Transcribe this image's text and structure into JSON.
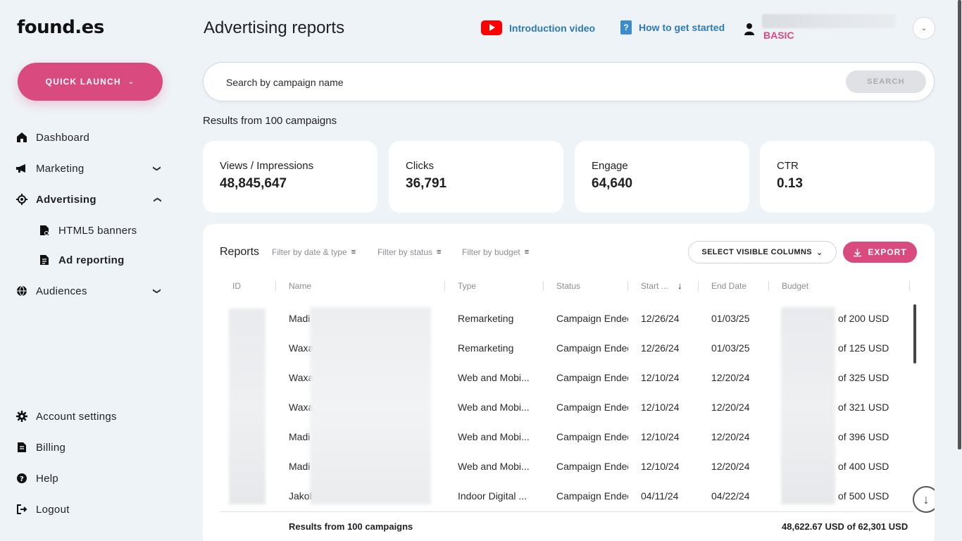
{
  "brand": {
    "logo_text": "found.es"
  },
  "sidebar": {
    "quick_launch": "QUICK LAUNCH",
    "items": [
      {
        "label": "Dashboard",
        "icon": "home-icon"
      },
      {
        "label": "Marketing",
        "icon": "megaphone-icon"
      },
      {
        "label": "Advertising",
        "icon": "target-icon"
      },
      {
        "label": "HTML5 banners",
        "icon": "banner-doc-icon"
      },
      {
        "label": "Ad reporting",
        "icon": "report-doc-icon"
      },
      {
        "label": "Audiences",
        "icon": "globe-icon"
      }
    ],
    "bottom": [
      {
        "label": "Account settings",
        "icon": "gear-icon"
      },
      {
        "label": "Billing",
        "icon": "billing-doc-icon"
      },
      {
        "label": "Help",
        "icon": "help-icon"
      },
      {
        "label": "Logout",
        "icon": "logout-icon"
      }
    ]
  },
  "header": {
    "title": "Advertising reports",
    "intro_video": "Introduction video",
    "how_to": "How to get started",
    "plan": "BASIC"
  },
  "search": {
    "placeholder": "Search by campaign name",
    "button": "SEARCH"
  },
  "results_label": "Results from 100 campaigns",
  "stats": [
    {
      "label": "Views / Impressions",
      "value": "48,845,647"
    },
    {
      "label": "Clicks",
      "value": "36,791"
    },
    {
      "label": "Engage",
      "value": "64,640"
    },
    {
      "label": "CTR",
      "value": "0.13"
    }
  ],
  "reports": {
    "title": "Reports",
    "filters": [
      "Filter by date & type",
      "Filter by status",
      "Filter by budget"
    ],
    "select_columns": "SELECT VISIBLE COLUMNS",
    "export": "EXPORT",
    "columns": [
      "ID",
      "Name",
      "Type",
      "Status",
      "Start ...",
      "End Date",
      "Budget"
    ],
    "rows": [
      {
        "name": "Madi",
        "type": "Remarketing",
        "status": "Campaign Ended",
        "start": "12/26/24",
        "end": "01/03/25",
        "budget": "of 200 USD"
      },
      {
        "name": "Waxa",
        "type": "Remarketing",
        "status": "Campaign Ended",
        "start": "12/26/24",
        "end": "01/03/25",
        "budget": "of 125 USD"
      },
      {
        "name": "Waxa",
        "type": "Web and Mobi...",
        "status": "Campaign Ended",
        "start": "12/10/24",
        "end": "12/20/24",
        "budget": "of 325 USD"
      },
      {
        "name": "Waxa",
        "type": "Web and Mobi...",
        "status": "Campaign Ended",
        "start": "12/10/24",
        "end": "12/20/24",
        "budget": "of 321 USD"
      },
      {
        "name": "Madi",
        "type": "Web and Mobi...",
        "status": "Campaign Ended",
        "start": "12/10/24",
        "end": "12/20/24",
        "budget": "of 396 USD"
      },
      {
        "name": "Madi",
        "type": "Web and Mobi...",
        "status": "Campaign Ended",
        "start": "12/10/24",
        "end": "12/20/24",
        "budget": "of 400 USD"
      },
      {
        "name": "Jakob",
        "type": "Indoor Digital ...",
        "status": "Campaign Ended",
        "start": "04/11/24",
        "end": "04/22/24",
        "budget": "of 500 USD"
      }
    ],
    "footer_left": "Results from 100 campaigns",
    "footer_right": "48,622.67 USD of 62,301 USD"
  },
  "colors": {
    "accent": "#d94a7e",
    "link": "#2d7ab8",
    "background": "#eef3f8"
  }
}
